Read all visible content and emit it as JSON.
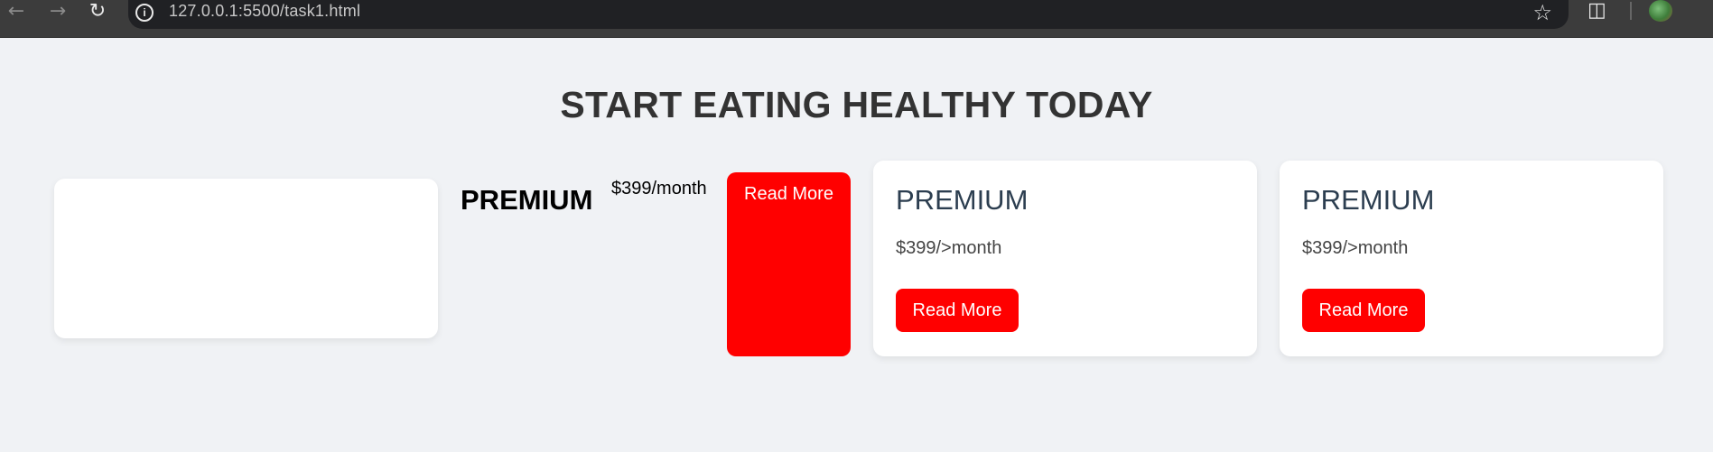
{
  "browser": {
    "url": "127.0.0.1:5500/task1.html",
    "back_icon": "arrow-left-icon",
    "forward_icon": "arrow-right-icon",
    "reload_icon": "reload-icon",
    "info_icon": "info-icon",
    "bookmark_icon": "star-icon",
    "extensions_icon": "puzzle-icon",
    "profile_icon": "avatar"
  },
  "page": {
    "title": "START EATING HEALTHY TODAY",
    "loose_item": {
      "title": "PREMIUM",
      "price": "$399/month",
      "button_label": "Read More"
    },
    "cards": [
      {
        "title": "PREMIUM",
        "price": "$399/>month",
        "button_label": "Read More"
      },
      {
        "title": "PREMIUM",
        "price": "$399/>month",
        "button_label": "Read More"
      }
    ]
  },
  "colors": {
    "accent": "#ff0000",
    "background": "#f0f2f5",
    "card_title": "#2c3e50",
    "heading": "#333333"
  }
}
